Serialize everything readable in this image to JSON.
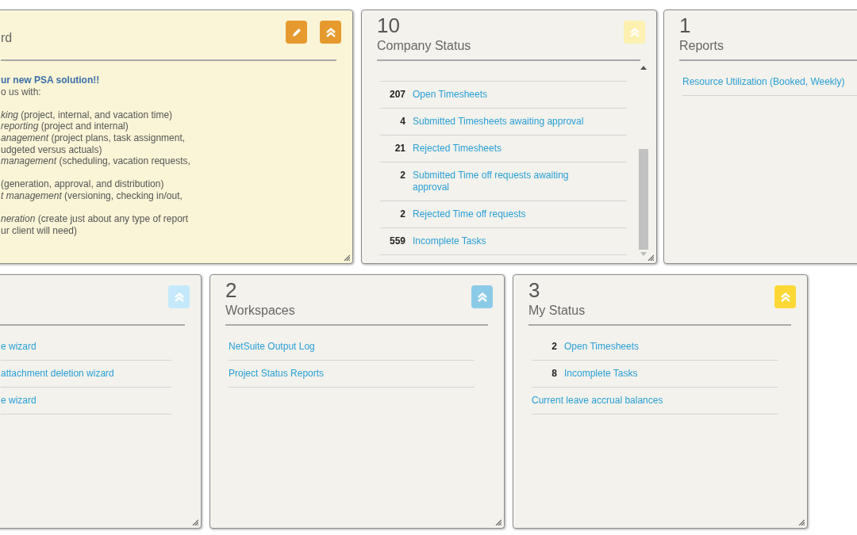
{
  "rows": [
    {
      "cards": [
        {
          "kind": "intro",
          "title": "rd",
          "color": "#e69a2e",
          "edit_button": true,
          "resizable": true,
          "heading": "ur new PSA solution!!",
          "lead": "o us with:",
          "groups": [
            [
              "*king* (project, internal, and vacation time)",
              "*reporting* (project and internal)",
              "*anagement* (project plans, task assignment,",
              "udgeted versus actuals)",
              "*management* (scheduling, vacation requests,"
            ],
            [
              "(generation, approval, and distribution)",
              "*t management* (versioning, checking in/out,"
            ],
            [
              "*neration* (create just about any type of report",
              "ur client will need)"
            ]
          ]
        },
        {
          "kind": "list",
          "count": "10",
          "title": "Company Status",
          "color": "#fdf0b0",
          "scrollable": true,
          "resizable": true,
          "items": [
            {
              "count": "207",
              "label": "Open Timesheets"
            },
            {
              "count": "4",
              "label": "Submitted Timesheets awaiting approval"
            },
            {
              "count": "21",
              "label": "Rejected Timesheets"
            },
            {
              "count": "2",
              "label": "Submitted Time off requests awaiting approval"
            },
            {
              "count": "2",
              "label": "Rejected Time off requests"
            },
            {
              "count": "559",
              "label": "Incomplete Tasks"
            }
          ]
        },
        {
          "kind": "list",
          "count": "1",
          "title": "Reports",
          "items": [
            {
              "label": "Resource Utilization (Booked, Weekly)"
            }
          ]
        }
      ]
    },
    {
      "cards": [
        {
          "kind": "list",
          "color": "#c5e9fb",
          "resizable": true,
          "items": [
            {
              "label": "e wizard"
            },
            {
              "label": "attachment deletion wizard"
            },
            {
              "label": "e wizard"
            }
          ]
        },
        {
          "kind": "list",
          "count": "2",
          "title": "Workspaces",
          "color": "#8ccbe8",
          "resizable": true,
          "items": [
            {
              "label": "NetSuite Output Log"
            },
            {
              "label": "Project Status Reports"
            }
          ]
        },
        {
          "kind": "list",
          "count": "3",
          "title": "My Status",
          "color": "#fdd835",
          "resizable": true,
          "items": [
            {
              "count": "2",
              "label": "Open Timesheets"
            },
            {
              "count": "8",
              "label": "Incomplete Tasks"
            },
            {
              "label": "Current leave accrual balances"
            }
          ]
        }
      ]
    }
  ]
}
